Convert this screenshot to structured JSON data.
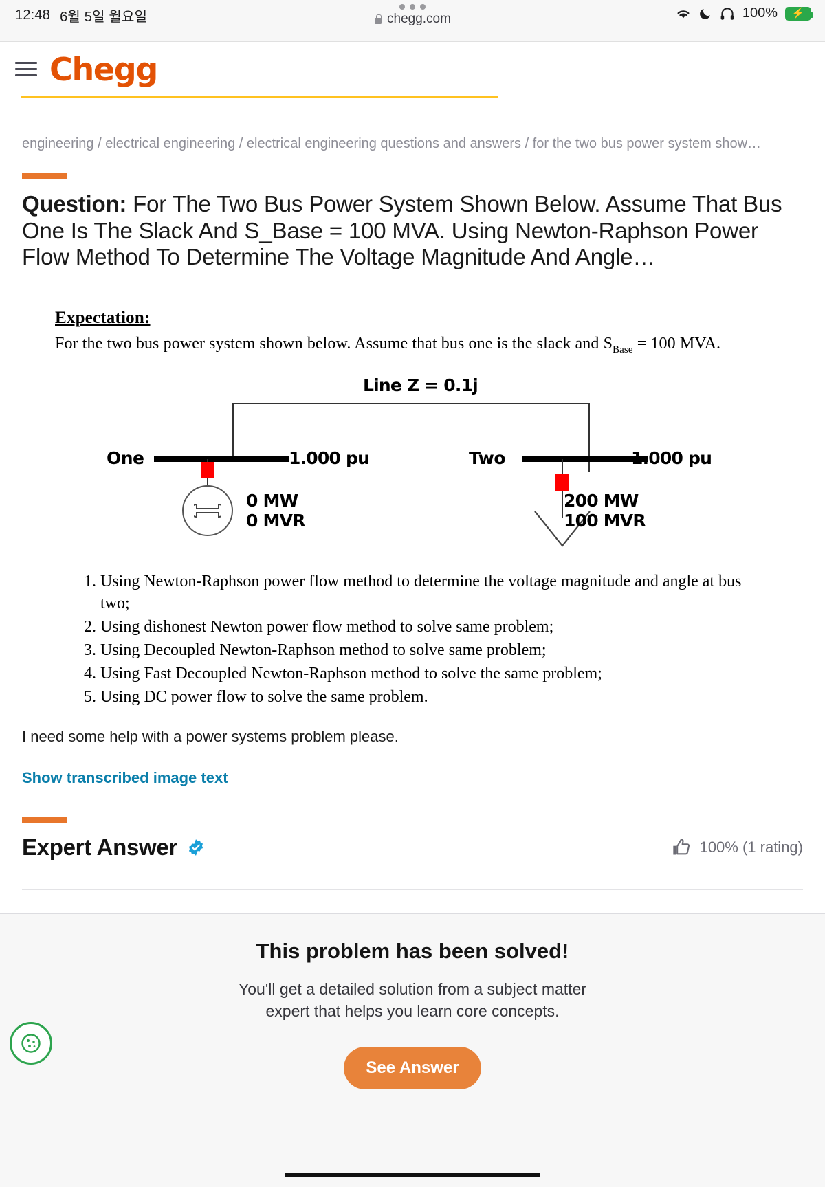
{
  "statusbar": {
    "time": "12:48",
    "date": "6월 5일 월요일",
    "battery_percent": "100%",
    "wifi_icon": "wifi-icon",
    "dnd_icon": "moon-icon",
    "headphones_icon": "headphones-icon",
    "battery_icon": "battery-charging-icon"
  },
  "browser": {
    "url": "chegg.com",
    "lock_icon": "lock-icon",
    "tabs_icon": "three-dots-icon"
  },
  "header": {
    "logo_text": "Chegg",
    "menu_icon": "hamburger-menu-icon",
    "progress_color": "#ffc220",
    "accent_color": "#e8762b"
  },
  "breadcrumb": "engineering / electrical engineering / electrical engineering questions and answers / for the two bus power system show…",
  "question": {
    "label": "Question:",
    "text": "For The Two Bus Power System Shown Below. Assume That Bus One Is The Slack And S_Base = 100 MVA. Using Newton-Raphson Power Flow Method To Determine The Voltage Magnitude And Angle…"
  },
  "question_image": {
    "expectation_heading": "Expectation:",
    "expectation_body_pre": "For the two bus power system shown below.  Assume that bus one is the slack and S",
    "expectation_body_sub": "Base",
    "expectation_body_post": " = 100 MVA.",
    "diagram": {
      "line_label": "Line Z = 0.1j",
      "bus_one_label": "One",
      "bus_one_voltage": "1.000 pu",
      "bus_one_mw": "0 MW",
      "bus_one_mvr": "0 MVR",
      "bus_two_label": "Two",
      "bus_two_voltage": "1.000 pu",
      "bus_two_mw": "200 MW",
      "bus_two_mvr": "100 MVR",
      "generator_icon": "generator-icon",
      "load_arrow_icon": "load-arrow-icon",
      "breaker_color": "#ff0000"
    },
    "tasks": [
      "Using Newton-Raphson power flow method to determine the voltage magnitude and angle at bus two;",
      "Using dishonest Newton power flow method to solve same problem;",
      "Using Decoupled Newton-Raphson method to solve same problem;",
      "Using Fast Decoupled Newton-Raphson method to solve the same problem;",
      "Using DC power flow to solve the same problem."
    ]
  },
  "user_note": "I need some help with a power systems problem please.",
  "transcribe_link": "Show transcribed image text",
  "expert_answer": {
    "title": "Expert Answer",
    "verified_icon": "verified-badge-icon",
    "thumb_icon": "thumbs-up-icon",
    "rating": "100% (1 rating)"
  },
  "solved_panel": {
    "title": "This problem has been solved!",
    "subtitle_line1": "You'll get a detailed solution from a subject matter",
    "subtitle_line2": "expert that helps you learn core concepts.",
    "cta_label": "See Answer",
    "cta_color": "#e8833a"
  },
  "cookie_button": {
    "icon": "cookie-settings-icon"
  }
}
